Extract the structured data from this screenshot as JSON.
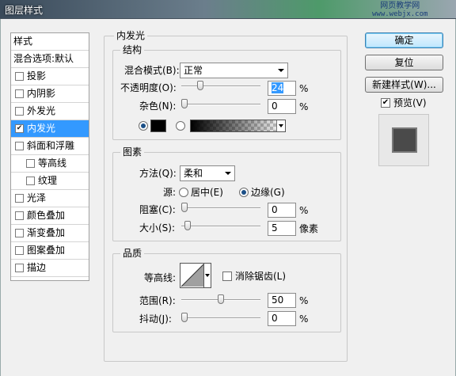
{
  "window": {
    "title": "图层样式"
  },
  "watermark": {
    "line1": "网页教学网",
    "line2": "www.webjx.com"
  },
  "style_list": {
    "header": "样式",
    "items": [
      {
        "label": "混合选项:默认",
        "checkbox": false
      },
      {
        "label": "投影",
        "checkbox": true,
        "checked": false
      },
      {
        "label": "内阴影",
        "checkbox": true,
        "checked": false
      },
      {
        "label": "外发光",
        "checkbox": true,
        "checked": false
      },
      {
        "label": "内发光",
        "checkbox": true,
        "checked": true,
        "selected": true
      },
      {
        "label": "斜面和浮雕",
        "checkbox": true,
        "checked": false
      },
      {
        "label": "等高线",
        "checkbox": true,
        "checked": false,
        "sub": true
      },
      {
        "label": "纹理",
        "checkbox": true,
        "checked": false,
        "sub": true
      },
      {
        "label": "光泽",
        "checkbox": true,
        "checked": false
      },
      {
        "label": "颜色叠加",
        "checkbox": true,
        "checked": false
      },
      {
        "label": "渐变叠加",
        "checkbox": true,
        "checked": false
      },
      {
        "label": "图案叠加",
        "checkbox": true,
        "checked": false
      },
      {
        "label": "描边",
        "checkbox": true,
        "checked": false
      }
    ]
  },
  "buttons": {
    "ok": "确定",
    "reset": "复位",
    "new_style": "新建样式(W)...",
    "preview_label": "预览(V)",
    "preview_checked": true
  },
  "panel": {
    "title": "内发光",
    "structure": {
      "title": "结构",
      "blend_mode_label": "混合模式(B):",
      "blend_mode_value": "正常",
      "opacity_label": "不透明度(O):",
      "opacity_value": "24",
      "opacity_percent": 24,
      "noise_label": "杂色(N):",
      "noise_value": "0",
      "noise_percent": 0,
      "unit": "%",
      "color_mode": "solid",
      "solid_color": "#000000"
    },
    "elements": {
      "title": "图素",
      "technique_label": "方法(Q):",
      "technique_value": "柔和",
      "source_label": "源:",
      "source_center": "居中(E)",
      "source_edge": "边缘(G)",
      "source_selected": "edge",
      "choke_label": "阻塞(C):",
      "choke_value": "0",
      "choke_percent": 0,
      "size_label": "大小(S):",
      "size_value": "5",
      "size_fraction": 0.02,
      "size_unit": "像素",
      "unit": "%"
    },
    "quality": {
      "title": "品质",
      "contour_label": "等高线:",
      "antialias_label": "消除锯齿(L)",
      "antialias_checked": false,
      "range_label": "范围(R):",
      "range_value": "50",
      "range_percent": 50,
      "jitter_label": "抖动(J):",
      "jitter_value": "0",
      "jitter_percent": 0,
      "unit": "%"
    }
  },
  "colors": {
    "selection": "#3399ff",
    "glow_color": "#000000"
  }
}
